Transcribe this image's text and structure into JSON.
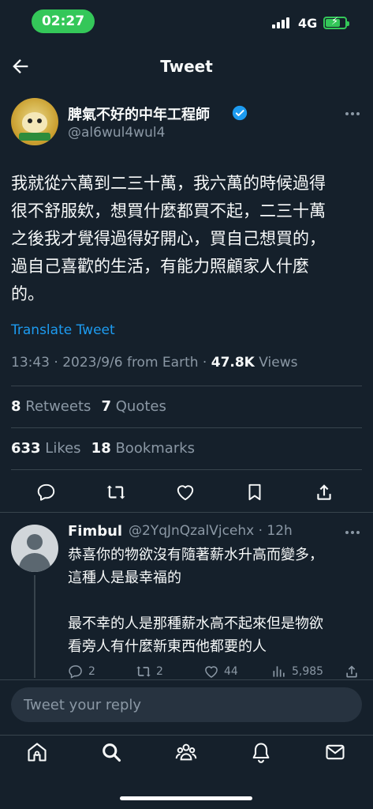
{
  "status_bar": {
    "time": "02:27",
    "network": "4G"
  },
  "header": {
    "title": "Tweet"
  },
  "tweet": {
    "author_name": "脾氣不好的中年工程師",
    "handle": "@al6wul4wul4",
    "text": "我就從六萬到二三十萬，我六萬的時候過得\n很不舒服欸，想買什麼都買不起，二三十萬\n之後我才覺得過得好開心，買自己想買的，\n過自己喜歡的生活，有能力照顧家人什麼\n的。",
    "translate_label": "Translate Tweet",
    "meta_time": "13:43 · 2023/9/6 from Earth · ",
    "views_count": "47.8K",
    "views_label": " Views",
    "retweets_count": "8",
    "retweets_label": " Retweets",
    "quotes_count": "7",
    "quotes_label": " Quotes",
    "likes_count": "633",
    "likes_label": " Likes",
    "bookmarks_count": "18",
    "bookmarks_label": " Bookmarks"
  },
  "reply": {
    "author_name": "Fimbul",
    "handle_time": "@2YqJnQzalVjcehx · 12h",
    "text": "恭喜你的物欲沒有隨著薪水升高而變多，\n這種人是最幸福的\n\n最不幸的人是那種薪水高不起來但是物欲\n看旁人有什麼新東西他都要的人",
    "replies": "2",
    "retweets": "2",
    "likes": "44",
    "views": "5,985"
  },
  "compose": {
    "placeholder": "Tweet your reply"
  },
  "colors": {
    "accent": "#1d9bf0",
    "background": "#15202b",
    "muted": "#8b98a5"
  },
  "icons": [
    "back-arrow-icon",
    "verified-badge-icon",
    "more-icon",
    "reply-icon",
    "retweet-icon",
    "like-icon",
    "bookmark-icon",
    "share-icon",
    "views-icon",
    "home-icon",
    "search-icon",
    "communities-icon",
    "notifications-icon",
    "messages-icon"
  ]
}
